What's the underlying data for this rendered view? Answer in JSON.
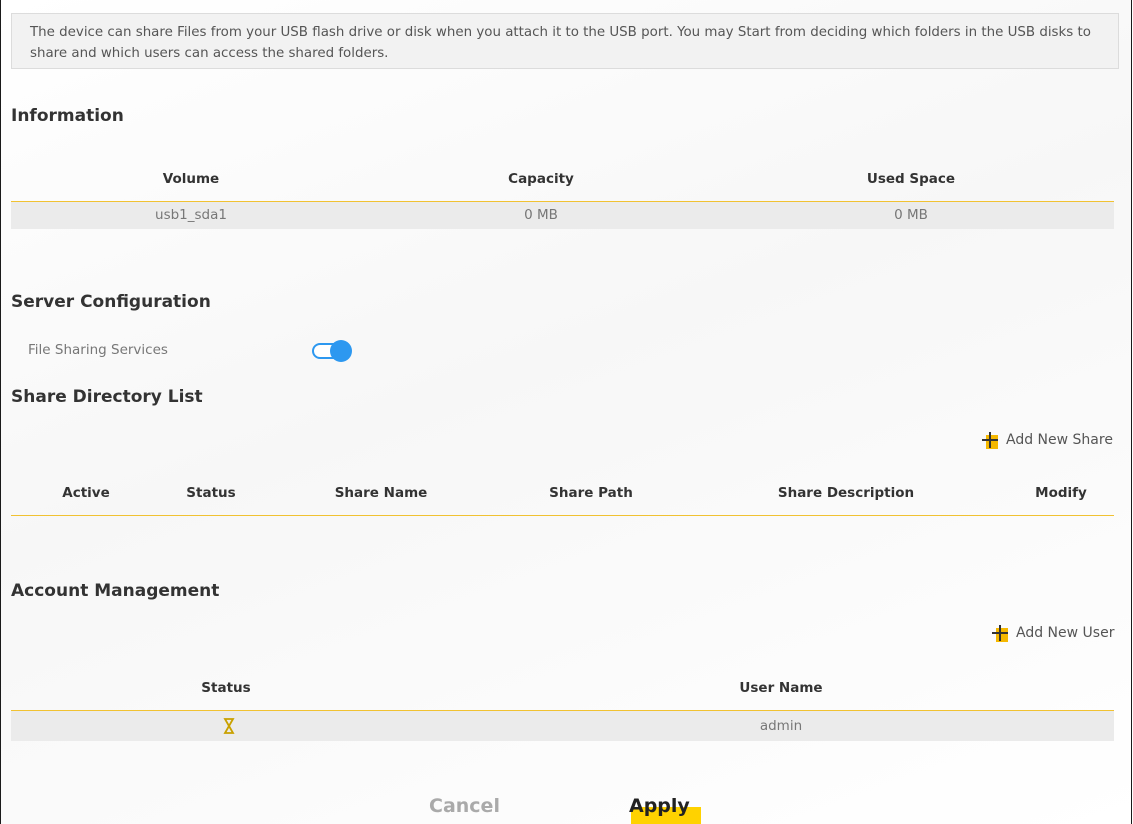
{
  "notice": {
    "text": "The device can share Files from your USB flash drive or disk when you attach it to the USB port. You may Start from deciding which folders in the USB disks to share and which users can access the shared folders."
  },
  "information": {
    "title": "Information",
    "columns": [
      "Volume",
      "Capacity",
      "Used Space"
    ],
    "rows": [
      [
        "usb1_sda1",
        "0 MB",
        "0 MB"
      ]
    ]
  },
  "server_configuration": {
    "title": "Server Configuration",
    "file_sharing_label": "File Sharing Services",
    "file_sharing_enabled": true,
    "toggle_color": "#2d98f0"
  },
  "share_directory": {
    "title": "Share Directory List",
    "add_label": "Add New Share",
    "columns": [
      "Active",
      "Status",
      "Share Name",
      "Share Path",
      "Share Description",
      "Modify"
    ]
  },
  "account_management": {
    "title": "Account Management",
    "add_label": "Add New User",
    "columns": [
      "Status",
      "User Name"
    ],
    "rows": [
      {
        "status_icon": "user-status-icon",
        "user_name": "admin"
      }
    ]
  },
  "buttons": {
    "cancel": "Cancel",
    "apply": "Apply"
  },
  "colors": {
    "accent": "#f5b800",
    "divider": "#f1c232",
    "row_bg": "#ebebeb"
  }
}
